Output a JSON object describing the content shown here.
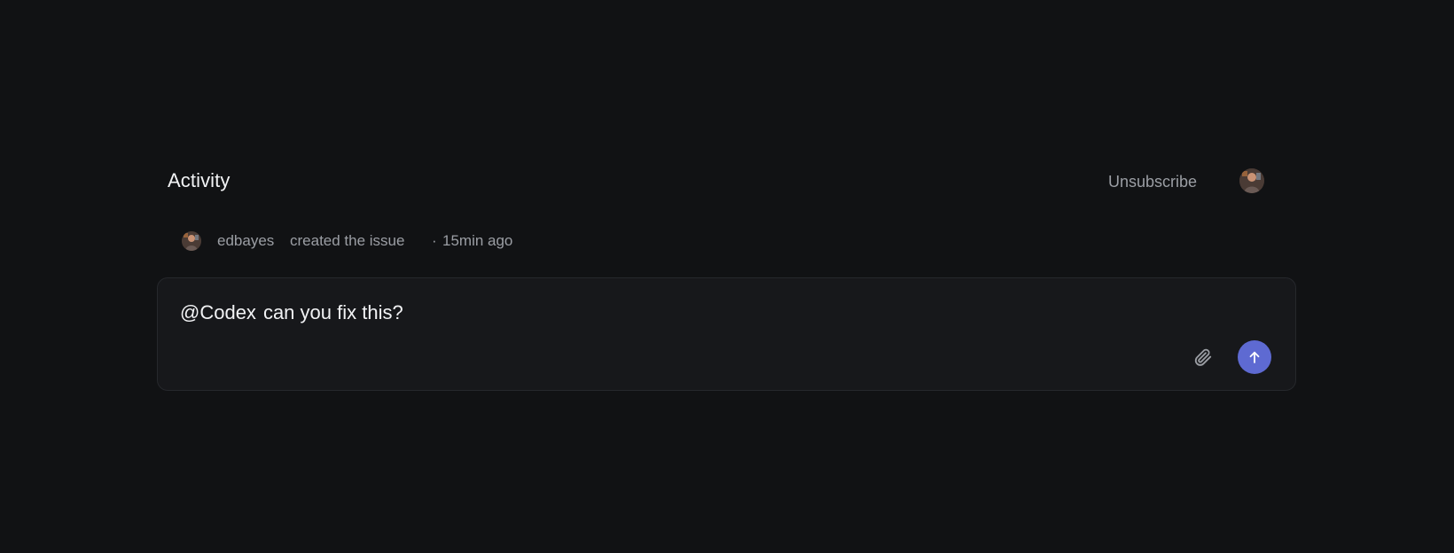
{
  "activity": {
    "title": "Activity",
    "unsubscribe_label": "Unsubscribe",
    "header_avatar_icon": "user-avatar"
  },
  "event": {
    "avatar_icon": "user-avatar",
    "user": "edbayes",
    "action": "created the issue",
    "separator": "·",
    "time": "15min ago"
  },
  "comment": {
    "mention": "@Codex",
    "text": "can you fix this?",
    "attach_icon": "paperclip-icon",
    "send_icon": "arrow-up-icon"
  },
  "colors": {
    "background": "#111214",
    "accent": "#5e6ad2",
    "box_background": "#17181b"
  }
}
